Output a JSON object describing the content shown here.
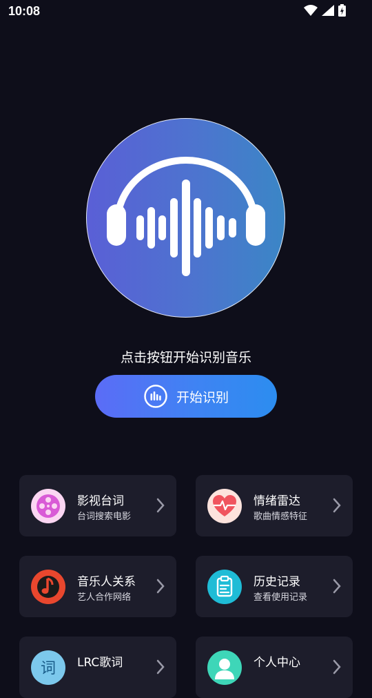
{
  "status_bar": {
    "time": "10:08"
  },
  "main": {
    "prompt": "点击按钮开始识别音乐",
    "start_button_label": "开始识别"
  },
  "features": [
    {
      "title": "影视台词",
      "subtitle": "台词搜索电影",
      "icon": "film-reel-icon"
    },
    {
      "title": "情绪雷达",
      "subtitle": "歌曲情感特征",
      "icon": "heartbeat-icon"
    },
    {
      "title": "音乐人关系",
      "subtitle": "艺人合作网络",
      "icon": "music-note-icon"
    },
    {
      "title": "历史记录",
      "subtitle": "查看使用记录",
      "icon": "clipboard-icon"
    },
    {
      "title": "LRC歌词",
      "subtitle": "",
      "icon": "lyrics-icon"
    },
    {
      "title": "个人中心",
      "subtitle": "",
      "icon": "user-icon"
    }
  ],
  "colors": {
    "background": "#0e0e1a",
    "card": "#1d1d2b",
    "accent_start": "#5b6cf6",
    "accent_end": "#2c8df0"
  }
}
